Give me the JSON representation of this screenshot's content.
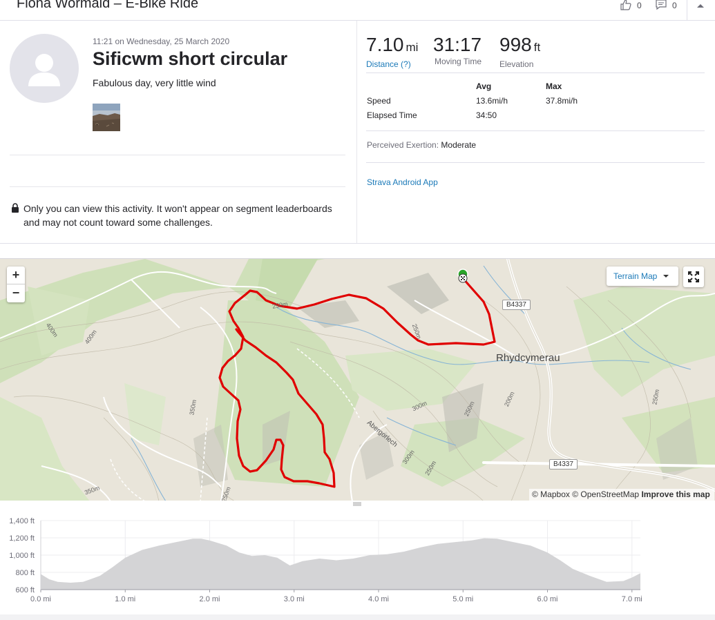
{
  "header": {
    "title": "Fiona Wormald – E-Bike Ride",
    "kudos_count": "0",
    "comment_count": "0"
  },
  "activity": {
    "datetime": "11:21 on Wednesday, 25 March 2020",
    "name": "Sificwm short circular",
    "description": "Fabulous day, very little wind",
    "privacy_notice": "Only you can view this activity. It won't appear on segment leaderboards and may not count toward some challenges."
  },
  "stats": {
    "distance": {
      "value": "7.10",
      "unit": "mi",
      "label": "Distance (?)"
    },
    "moving_time": {
      "value": "31:17",
      "label": "Moving Time"
    },
    "elevation": {
      "value": "998",
      "unit": "ft",
      "label": "Elevation"
    }
  },
  "more_stats": {
    "col_avg": "Avg",
    "col_max": "Max",
    "rows": [
      {
        "label": "Speed",
        "avg": "13.6mi/h",
        "max": "37.8mi/h"
      },
      {
        "label": "Elapsed Time",
        "avg": "34:50",
        "max": ""
      }
    ]
  },
  "exertion": {
    "label": "Perceived Exertion:",
    "value": "Moderate"
  },
  "device": "Strava Android App",
  "map": {
    "style_button": "Terrain Map",
    "zoom_in": "+",
    "zoom_out": "−",
    "town_label": "Rhydcymerau",
    "road_labels": [
      "B4337",
      "B4337"
    ],
    "place_label": "Abergorlech",
    "contour_labels": [
      "400m",
      "400m",
      "350m",
      "350m",
      "250m",
      "250m",
      "300m",
      "250m",
      "200m",
      "300m",
      "250m",
      "250m",
      "250m"
    ],
    "attribution_mapbox": "© Mapbox",
    "attribution_osm": "© OpenStreetMap",
    "attribution_improve": "Improve this map",
    "route_color": "#e00000"
  },
  "chart_data": {
    "type": "area",
    "xlabel": "",
    "ylabel": "",
    "xlim": [
      0,
      7.1
    ],
    "ylim": [
      600,
      1400
    ],
    "x_ticks": [
      "0.0 mi",
      "1.0 mi",
      "2.0 mi",
      "3.0 mi",
      "4.0 mi",
      "5.0 mi",
      "6.0 mi",
      "7.0 mi"
    ],
    "y_ticks": [
      "600 ft",
      "800 ft",
      "1,000 ft",
      "1,200 ft",
      "1,400 ft"
    ],
    "series": [
      {
        "x": [
          0.0,
          0.1,
          0.2,
          0.35,
          0.5,
          0.7,
          0.85,
          1.0,
          1.2,
          1.4,
          1.6,
          1.8,
          1.9,
          2.0,
          2.2,
          2.35,
          2.5,
          2.65,
          2.8,
          2.95,
          3.1,
          3.3,
          3.5,
          3.7,
          3.9,
          4.1,
          4.3,
          4.5,
          4.7,
          4.9,
          5.1,
          5.25,
          5.4,
          5.6,
          5.8,
          6.0,
          6.15,
          6.3,
          6.5,
          6.7,
          6.9,
          7.0,
          7.1
        ],
        "y": [
          780,
          720,
          690,
          680,
          690,
          760,
          860,
          970,
          1060,
          1110,
          1150,
          1190,
          1190,
          1170,
          1110,
          1030,
          990,
          1000,
          970,
          880,
          930,
          960,
          940,
          960,
          1000,
          1010,
          1040,
          1090,
          1130,
          1150,
          1170,
          1195,
          1190,
          1150,
          1110,
          1030,
          940,
          840,
          760,
          690,
          700,
          740,
          790
        ],
        "color": "#d4d4d6"
      }
    ]
  }
}
